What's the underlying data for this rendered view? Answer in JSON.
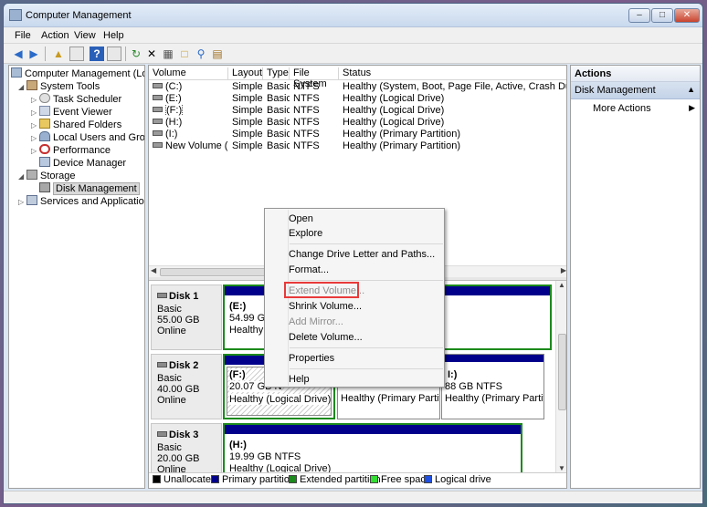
{
  "window": {
    "title": "Computer Management",
    "buttons": {
      "minimize": "–",
      "maximize": "□",
      "close": "✕"
    }
  },
  "menu": [
    "File",
    "Action",
    "View",
    "Help"
  ],
  "toolbar": {
    "icons": [
      "back-icon",
      "forward-icon",
      "up-folder-icon",
      "show-hide-tree-icon",
      "help-icon",
      "show-hide-action-pane-icon",
      "refresh-icon",
      "delete-icon",
      "properties-icon",
      "open-icon",
      "search-icon",
      "export-icon"
    ]
  },
  "tree": {
    "root": "Computer Management (Local",
    "system_tools": "System Tools",
    "items": [
      "Task Scheduler",
      "Event Viewer",
      "Shared Folders",
      "Local Users and Groups",
      "Performance",
      "Device Manager"
    ],
    "storage": "Storage",
    "disk_management": "Disk Management",
    "services": "Services and Applications"
  },
  "volumes": {
    "columns": [
      "Volume",
      "Layout",
      "Type",
      "File System",
      "Status"
    ],
    "rows": [
      {
        "volume": "(C:)",
        "layout": "Simple",
        "type": "Basic",
        "fs": "NTFS",
        "status": "Healthy (System, Boot, Page File, Active, Crash Dump, Prima"
      },
      {
        "volume": "(E:)",
        "layout": "Simple",
        "type": "Basic",
        "fs": "NTFS",
        "status": "Healthy (Logical Drive)"
      },
      {
        "volume": "(F:)",
        "layout": "Simple",
        "type": "Basic",
        "fs": "NTFS",
        "status": "Healthy (Logical Drive)"
      },
      {
        "volume": "(H:)",
        "layout": "Simple",
        "type": "Basic",
        "fs": "NTFS",
        "status": "Healthy (Logical Drive)"
      },
      {
        "volume": "(I:)",
        "layout": "Simple",
        "type": "Basic",
        "fs": "NTFS",
        "status": "Healthy (Primary Partition)"
      },
      {
        "volume": "New Volume (G:)",
        "layout": "Simple",
        "type": "Basic",
        "fs": "NTFS",
        "status": "Healthy (Primary Partition)"
      }
    ]
  },
  "disks": [
    {
      "name": "Disk 1",
      "type": "Basic",
      "size": "55.00 GB",
      "state": "Online",
      "partitions": [
        {
          "label": "(E:)",
          "size": "54.99 GB N",
          "status": "Healthy (L"
        }
      ]
    },
    {
      "name": "Disk 2",
      "type": "Basic",
      "size": "40.00 GB",
      "state": "Online",
      "partitions": [
        {
          "label": "(F:)",
          "size": "20.07 GB N",
          "status": "Healthy (Logical Drive)"
        },
        {
          "label": "",
          "size": "",
          "status": "Healthy (Primary Partitio"
        },
        {
          "label": "I:)",
          "size": "88 GB NTFS",
          "status": "Healthy (Primary Partitior"
        }
      ]
    },
    {
      "name": "Disk 3",
      "type": "Basic",
      "size": "20.00 GB",
      "state": "Online",
      "partitions": [
        {
          "label": "(H:)",
          "size": "19.99 GB NTFS",
          "status": "Healthy (Logical Drive)"
        }
      ]
    }
  ],
  "legend": [
    {
      "label": "Unallocated",
      "color": "#000000"
    },
    {
      "label": "Primary partition",
      "color": "#00008b"
    },
    {
      "label": "Extended partition",
      "color": "#1c8a1c"
    },
    {
      "label": "Free space",
      "color": "#33dd33"
    },
    {
      "label": "Logical drive",
      "color": "#2050e0"
    }
  ],
  "actions": {
    "header": "Actions",
    "section": "Disk Management",
    "more": "More Actions"
  },
  "context_menu": {
    "items": [
      {
        "label": "Open",
        "enabled": true
      },
      {
        "label": "Explore",
        "enabled": true
      },
      {
        "label": "Change Drive Letter and Paths...",
        "enabled": true
      },
      {
        "label": "Format...",
        "enabled": true
      },
      {
        "label": "Extend Volume...",
        "enabled": false,
        "highlighted": true
      },
      {
        "label": "Shrink Volume...",
        "enabled": true
      },
      {
        "label": "Add Mirror...",
        "enabled": false
      },
      {
        "label": "Delete Volume...",
        "enabled": true
      },
      {
        "label": "Properties",
        "enabled": true
      },
      {
        "label": "Help",
        "enabled": true
      }
    ]
  }
}
